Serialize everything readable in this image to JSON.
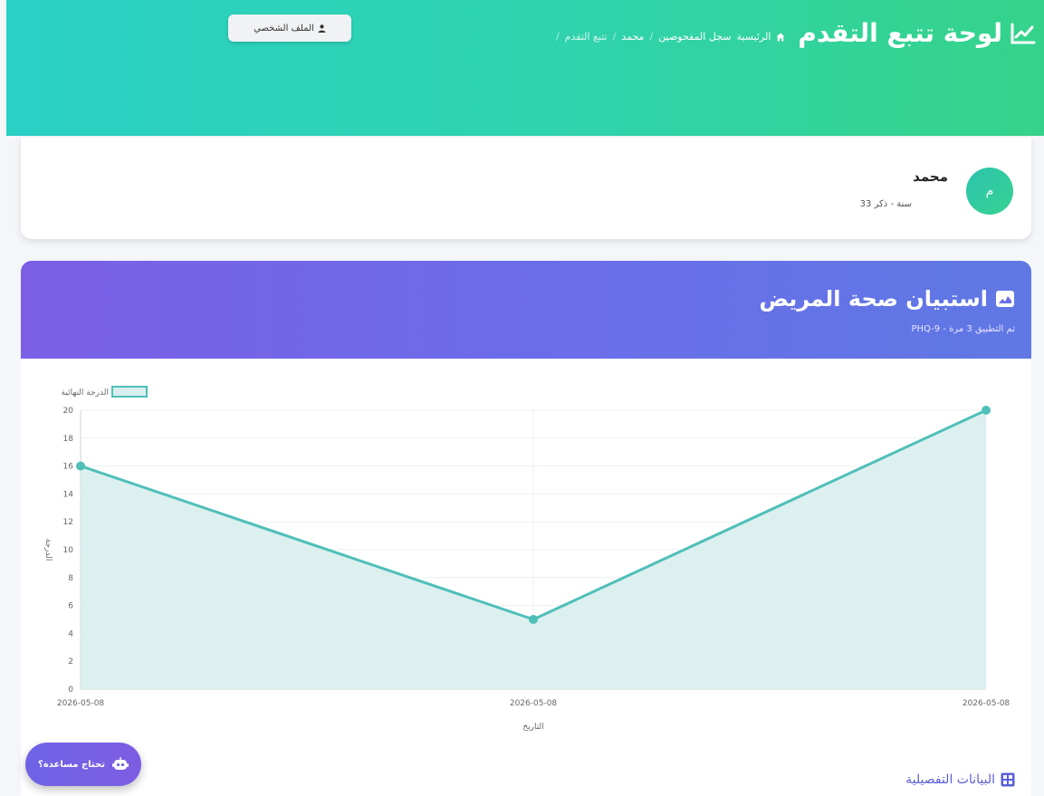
{
  "header": {
    "title": "لوحة تتبع التقدم",
    "breadcrumb": [
      "الرئيسية",
      "سجل المفحوصين",
      "محمد",
      "تتبع التقدم"
    ],
    "profile_button": "الملف الشخصي",
    "accent": "#2fd3b0"
  },
  "patient": {
    "avatar_letter": "م",
    "name": "محمد",
    "info": "33 سنة - ذكر"
  },
  "questionnaire": {
    "title": "استبيان صحة المريض",
    "subtitle": "PHQ-9 - تم التطبيق 3 مرة",
    "details_title": "البيانات التفصيلية",
    "accent": "#6a6ee8"
  },
  "chart_data": {
    "type": "area",
    "series": [
      {
        "name": "الدرجة النهائية",
        "values": [
          16,
          5,
          20
        ]
      }
    ],
    "categories": [
      "2026-05-08",
      "2026-05-08",
      "2026-05-08"
    ],
    "xlabel": "التاريخ",
    "ylabel": "الدرجة",
    "ylim": [
      0,
      20
    ],
    "yticks": [
      0,
      2,
      4,
      6,
      8,
      10,
      12,
      14,
      16,
      18,
      20
    ],
    "legend": "top-left",
    "grid": true,
    "line_color": "#4fbfb8",
    "fill_color": "#d9eeee"
  },
  "help": {
    "label": "تحتاج مساعدة؟"
  }
}
